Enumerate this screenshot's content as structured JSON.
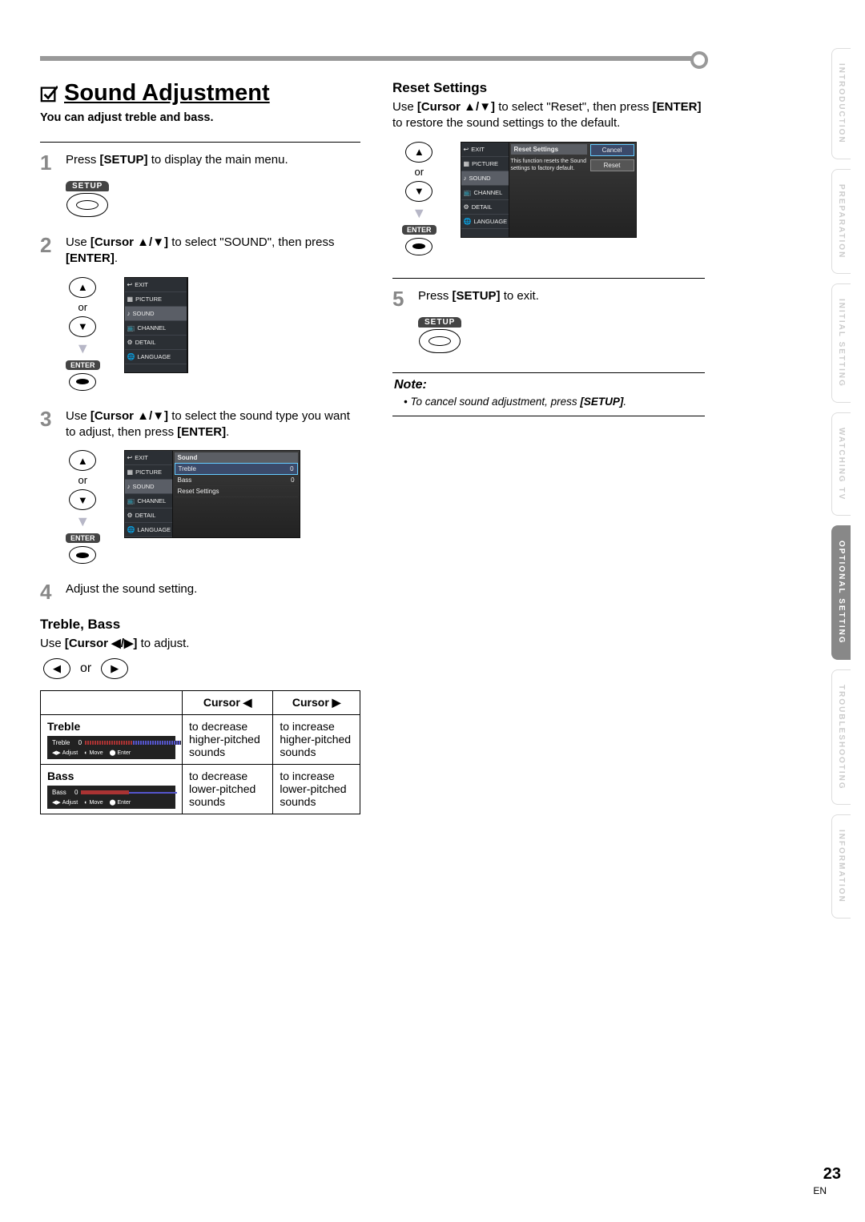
{
  "title": "Sound Adjustment",
  "intro": "You can adjust treble and bass.",
  "steps": {
    "s1": {
      "num": "1",
      "text_a": "Press ",
      "btn": "SETUP",
      "text_b": " to display the main menu."
    },
    "s2": {
      "num": "2",
      "text_a": "Use ",
      "cmd": "[Cursor ▲/▼]",
      "text_b": " to select \"SOUND\", then press ",
      "cmd2": "[ENTER]",
      "text_c": "."
    },
    "s3": {
      "num": "3",
      "text_a": "Use ",
      "cmd": "[Cursor ▲/▼]",
      "text_b": " to select the sound type you want to adjust, then press ",
      "cmd2": "[ENTER]",
      "text_c": "."
    },
    "s4": {
      "num": "4",
      "text": "Adjust the sound setting."
    },
    "s5": {
      "num": "5",
      "text_a": "Press ",
      "btn": "SETUP",
      "text_b": " to exit."
    }
  },
  "setup_label": "SETUP",
  "enter_label": "ENTER",
  "or_label": "or",
  "treble_bass": {
    "heading": "Treble, Bass",
    "text_a": "Use ",
    "cmd": "[Cursor ◀/▶]",
    "text_b": " to adjust."
  },
  "table": {
    "h_blank": "",
    "h_left": "Cursor ◀",
    "h_right": "Cursor ▶",
    "r1_name": "Treble",
    "r1_left": "to decrease higher-pitched sounds",
    "r1_right": "to increase higher-pitched sounds",
    "r2_name": "Bass",
    "r2_left": "to decrease lower-pitched sounds",
    "r2_right": "to increase lower-pitched sounds"
  },
  "osd_nav": [
    "EXIT",
    "PICTURE",
    "SOUND",
    "CHANNEL",
    "DETAIL",
    "LANGUAGE"
  ],
  "osd_sound": {
    "title": "Sound",
    "rows": [
      {
        "label": "Treble",
        "val": "0",
        "sel": true
      },
      {
        "label": "Bass",
        "val": "0"
      },
      {
        "label": "Reset Settings",
        "val": ""
      }
    ]
  },
  "slider_ctl": {
    "adjust": "Adjust",
    "move": "Move",
    "enter": "Enter",
    "zero": "0"
  },
  "reset": {
    "heading": "Reset Settings",
    "text_a": "Use ",
    "cmd": "[Cursor ▲/▼]",
    "text_b": " to select \"Reset\", then press ",
    "cmd2": "[ENTER]",
    "text_c": " to restore the sound settings to the default.",
    "osd_title": "Reset Settings",
    "msg": "This function resets the Sound settings to factory default.",
    "btn_cancel": "Cancel",
    "btn_reset": "Reset"
  },
  "note": {
    "head": "Note:",
    "body_a": "To cancel sound adjustment, press ",
    "cmd": "[SETUP]",
    "body_b": "."
  },
  "tabs": [
    "INTRODUCTION",
    "PREPARATION",
    "INITIAL SETTING",
    "WATCHING TV",
    "OPTIONAL SETTING",
    "TROUBLESHOOTING",
    "INFORMATION"
  ],
  "tab_active_index": 4,
  "page_number": "23",
  "lang": "EN"
}
